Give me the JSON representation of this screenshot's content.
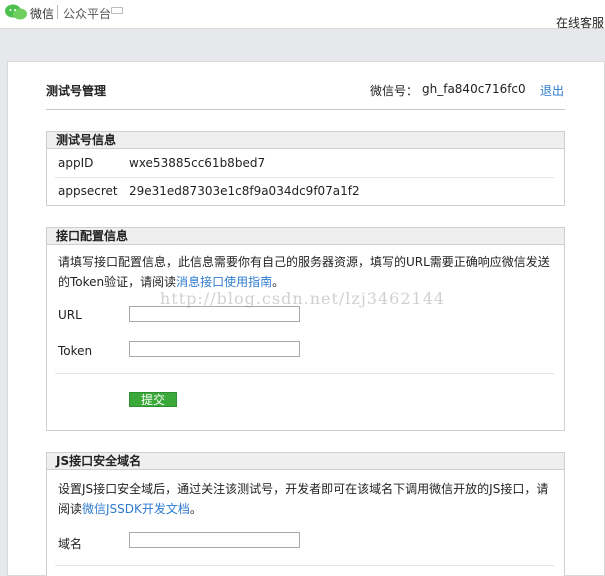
{
  "topbar": {
    "brand": "微信",
    "platform": "公众平台",
    "service_link": "在线客服"
  },
  "header": {
    "title": "测试号管理",
    "account_label": "微信号：",
    "account_value": "gh_fa840c716fc0",
    "logout": "退出"
  },
  "test_account": {
    "title": "测试号信息",
    "appid_label": "appID",
    "appid_value": "wxe53885cc61b8bed7",
    "appsecret_label": "appsecret",
    "appsecret_value": "29e31ed87303e1c8f9a034dc9f07a1f2"
  },
  "interface_config": {
    "title": "接口配置信息",
    "desc_part1": "请填写接口配置信息，此信息需要你有自己的服务器资源，填写的URL需要正确响应微信发送",
    "desc_part2": "的Token验证，请阅读",
    "desc_link": "消息接口使用指南",
    "desc_end": "。",
    "url_label": "URL",
    "url_value": "",
    "token_label": "Token",
    "token_value": "",
    "submit_label": "提交"
  },
  "js_domain": {
    "title": "JS接口安全域名",
    "desc_part1": "设置JS接口安全域后，通过关注该测试号，开发者即可在该域名下调用微信开放的JS接口，请",
    "desc_part2": "阅读",
    "desc_link": "微信JSSDK开发文档",
    "desc_end": "。",
    "domain_label": "域名",
    "domain_value": ""
  },
  "watermark": "http://blog.csdn.net/lzj3462144",
  "colors": {
    "link": "#2e7bcf",
    "submit": "#3aa93a",
    "logo": "#4cbf4c"
  },
  "icons": {
    "logo": "wechat-logo-icon"
  }
}
